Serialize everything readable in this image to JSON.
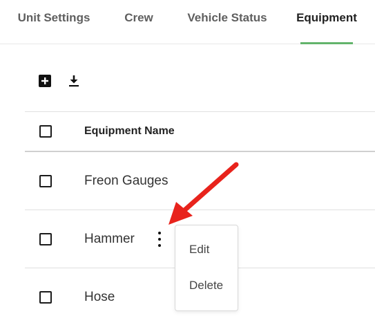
{
  "tabs": [
    {
      "label": "Unit Settings"
    },
    {
      "label": "Crew"
    },
    {
      "label": "Vehicle Status"
    },
    {
      "label": "Equipment"
    }
  ],
  "active_tab": "Equipment",
  "toolbar": {
    "add_icon": "add-box-icon",
    "download_icon": "download-icon"
  },
  "table": {
    "header": "Equipment Name",
    "rows": [
      {
        "name": "Freon Gauges"
      },
      {
        "name": "Hammer"
      },
      {
        "name": "Hose"
      }
    ]
  },
  "row_menu": {
    "items": [
      "Edit",
      "Delete"
    ]
  },
  "colors": {
    "active_tab_underline": "#62b46b",
    "annotation_arrow": "#e8231c"
  }
}
